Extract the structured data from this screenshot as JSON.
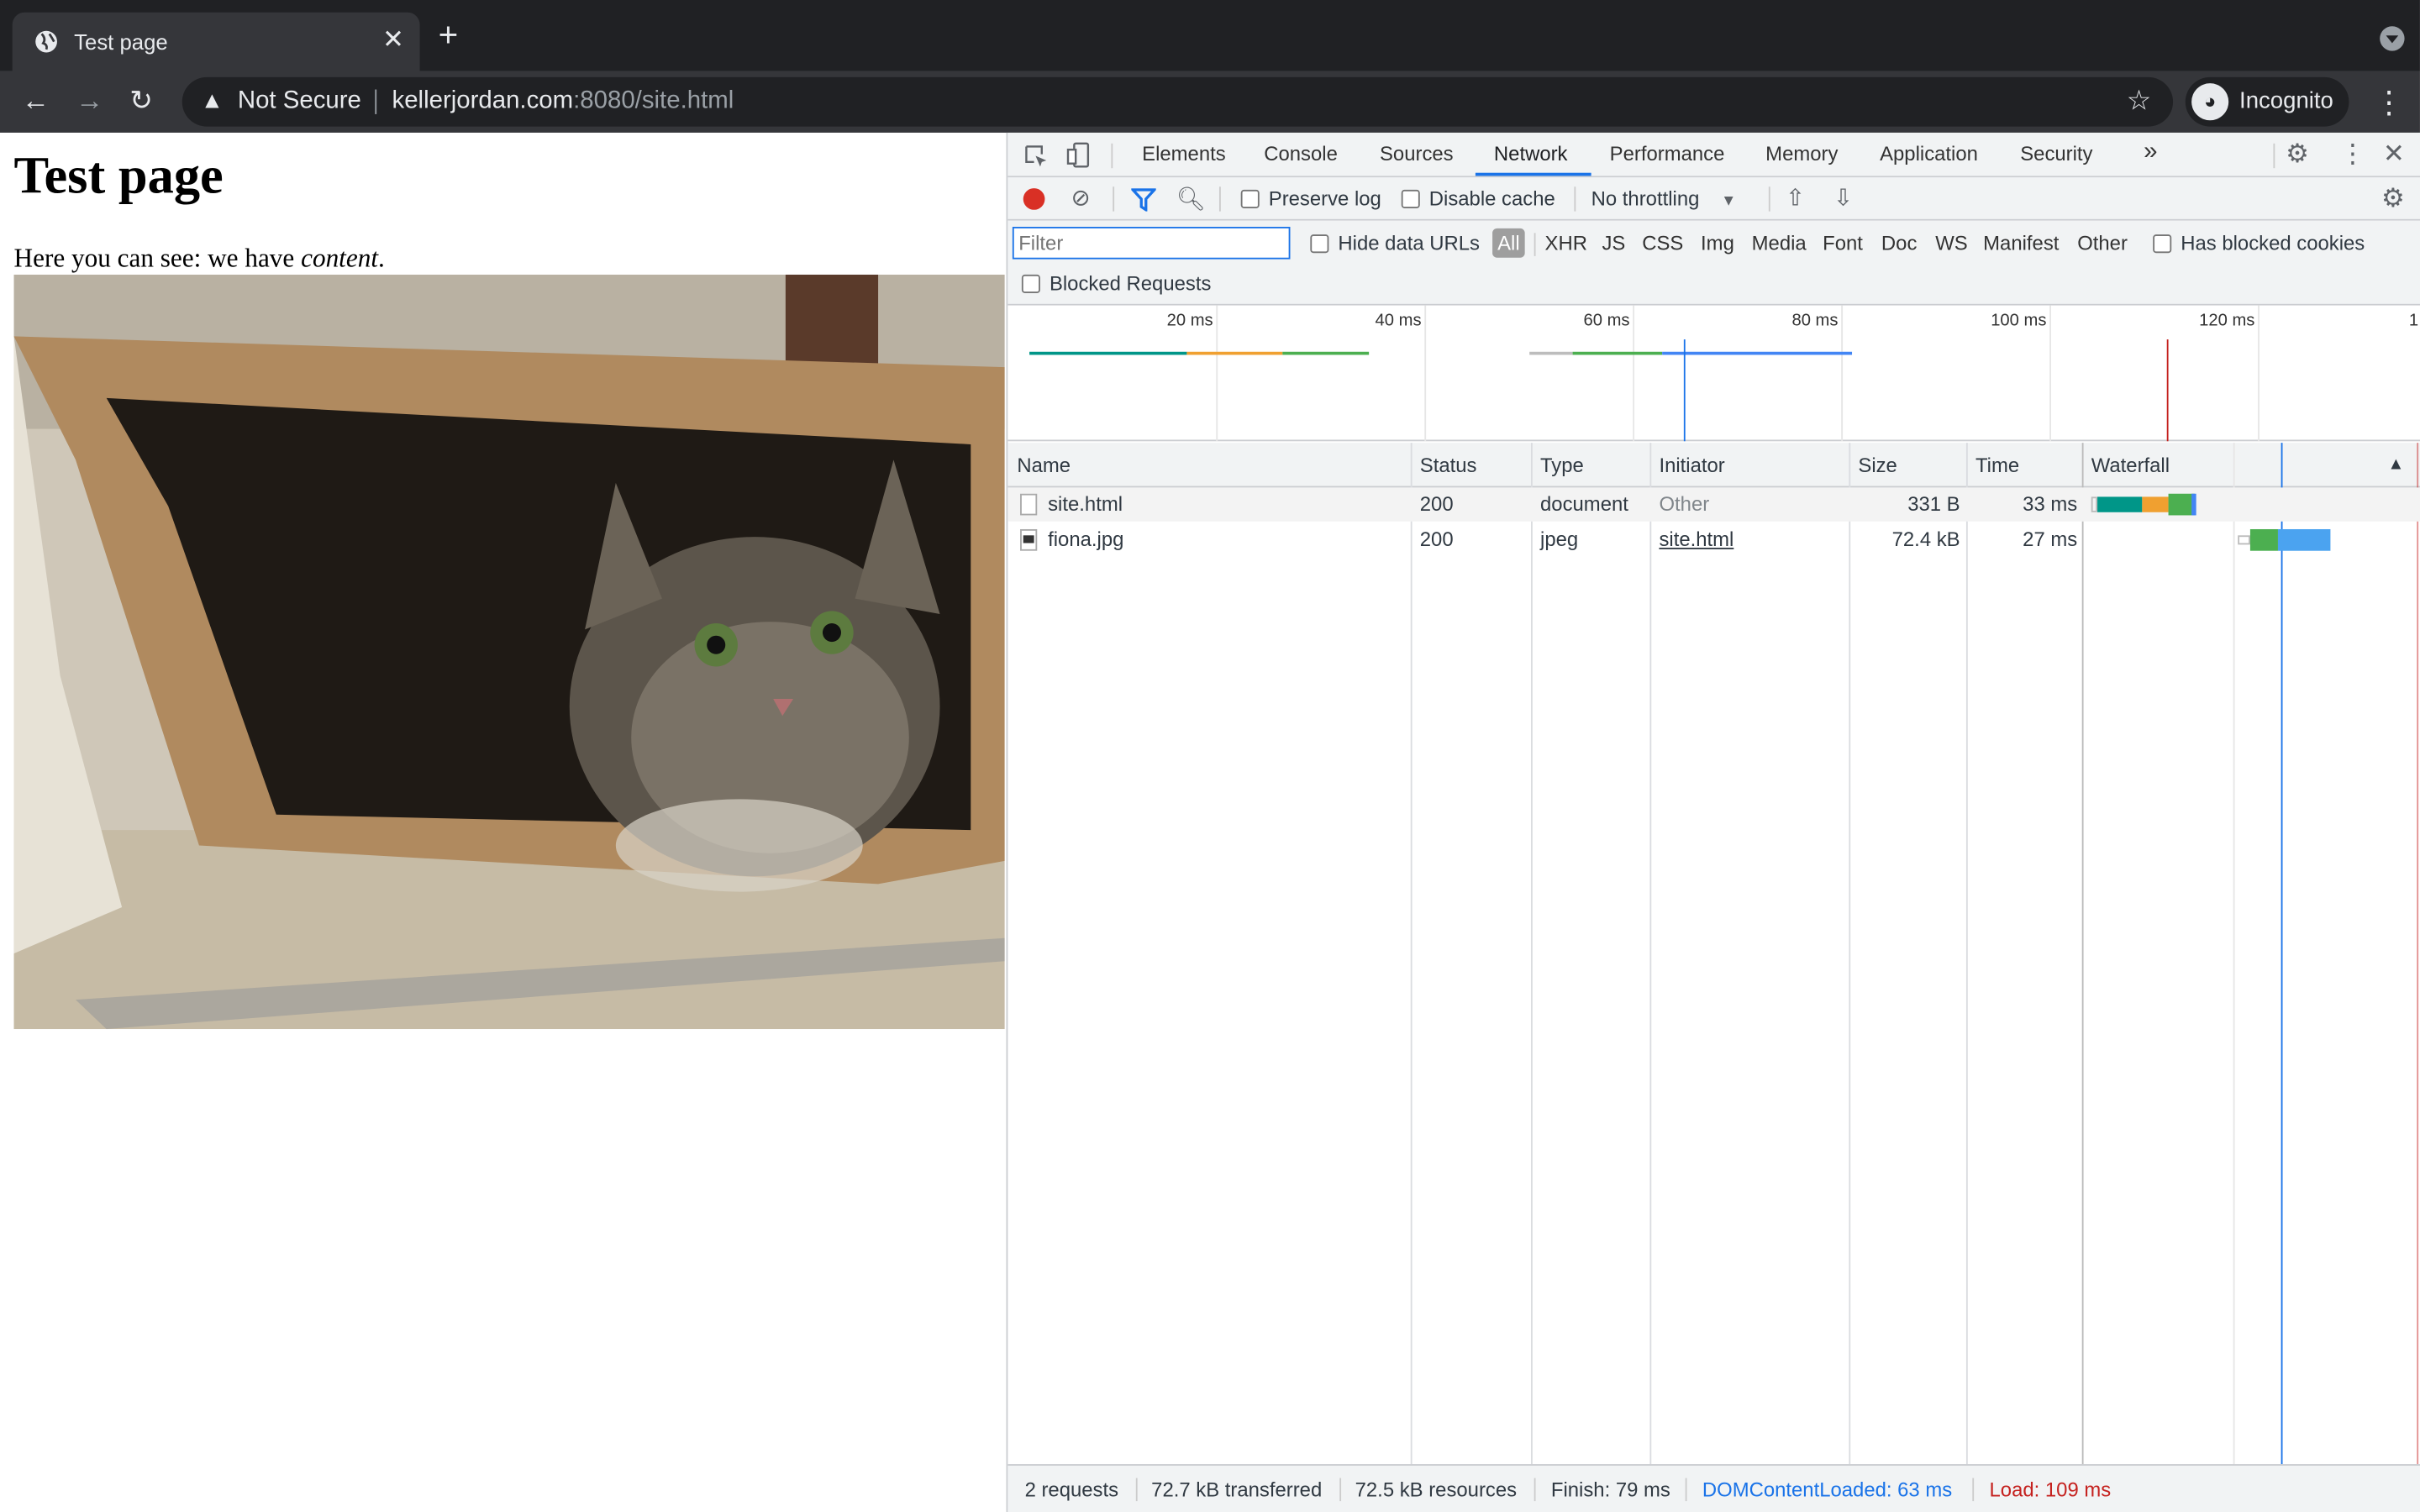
{
  "browser": {
    "tab_title": "Test page",
    "security_label": "Not Secure",
    "url_host": "kellerjordan.com",
    "url_rest": ":8080/site.html",
    "profile_label": "Incognito"
  },
  "page": {
    "heading": "Test page",
    "text_before": "Here you can see: we have ",
    "text_em": "content",
    "text_after": ".",
    "image_subject": "cat in paper bag"
  },
  "devtools": {
    "tabs": [
      "Elements",
      "Console",
      "Sources",
      "Network",
      "Performance",
      "Memory",
      "Application",
      "Security"
    ],
    "more_tabs_glyph": "»",
    "preserve_log": "Preserve log",
    "disable_cache": "Disable cache",
    "throttling": "No throttling",
    "filter_placeholder": "Filter",
    "hide_data_urls": "Hide data URLs",
    "type_filters": [
      "All",
      "XHR",
      "JS",
      "CSS",
      "Img",
      "Media",
      "Font",
      "Doc",
      "WS",
      "Manifest",
      "Other"
    ],
    "has_blocked_cookies": "Has blocked cookies",
    "blocked_requests": "Blocked Requests",
    "overview_ticks": [
      "20 ms",
      "40 ms",
      "60 ms",
      "80 ms",
      "100 ms",
      "120 ms",
      "1"
    ],
    "columns": {
      "name": "Name",
      "status": "Status",
      "type": "Type",
      "initiator": "Initiator",
      "size": "Size",
      "time": "Time",
      "waterfall": "Waterfall"
    },
    "sort_indicator": "▲",
    "rows": [
      {
        "name": "site.html",
        "status": "200",
        "type": "document",
        "initiator": "Other",
        "size": "331 B",
        "time": "33 ms"
      },
      {
        "name": "fiona.jpg",
        "status": "200",
        "type": "jpeg",
        "initiator": "site.html",
        "size": "72.4 kB",
        "time": "27 ms"
      }
    ],
    "summary": {
      "requests": "2 requests",
      "transferred": "72.7 kB transferred",
      "resources": "72.5 kB resources",
      "finish": "Finish: 79 ms",
      "dcl": "DOMContentLoaded: 63 ms",
      "load": "Load: 109 ms"
    }
  },
  "colors": {
    "dcl": "#1a73e8",
    "load": "#c5221f",
    "waiting": "#009688",
    "download": "#4285f4",
    "ttfb": "#4caf50"
  }
}
